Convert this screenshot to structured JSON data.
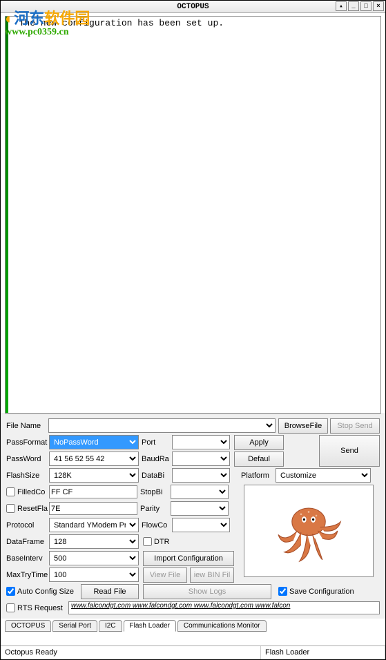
{
  "title": "OCTOPUS",
  "watermark": {
    "line1a": "河东",
    "line1b": "软件园",
    "line2": "www.pc0359.cn"
  },
  "console_text": "  The new configuration has been set up.",
  "form": {
    "file_name_label": "File Name",
    "file_name_value": "",
    "browse_file": "BrowseFile",
    "stop_send": "Stop Send",
    "passformat_label": "PassFormat",
    "passformat_value": "NoPassWord",
    "port_label": "Port",
    "port_value": "",
    "apply": "Apply",
    "send": "Send",
    "password_label": "PassWord",
    "password_value": "41 56 52 55 42",
    "baudrate_label": "BaudRa",
    "baudrate_value": "",
    "default": "Defaul",
    "flashsize_label": "FlashSize",
    "flashsize_value": "128K",
    "databits_label": "DataBi",
    "databits_value": "",
    "platform_label": "Platform",
    "platform_value": "Customize",
    "filledcode_label": "FilledCo",
    "filledcode_value": "FF CF",
    "stopbits_label": "StopBi",
    "stopbits_value": "",
    "resetflag_label": "ResetFla",
    "resetflag_value": "7E",
    "parity_label": "Parity",
    "parity_value": "",
    "protocol_label": "Protocol",
    "protocol_value": "Standard YModem Protoc",
    "flowcontrol_label": "FlowCo",
    "flowcontrol_value": "",
    "dtr_label": "DTR",
    "dataframe_label": "DataFrame",
    "dataframe_value": "128",
    "import_config": "Import Configuration",
    "baseinterval_label": "BaseInterv",
    "baseinterval_value": "500",
    "view_file": "View File",
    "view_bin": "iew BIN Fil",
    "maxtrytime_label": "MaxTryTime",
    "maxtrytime_value": "100",
    "auto_config_label": "Auto Config Size",
    "read_file": "Read File",
    "show_logs": "Show Logs",
    "save_config_label": "Save Configuration",
    "rts_label": "RTS Request",
    "url_text": "www.falcondgt.com www.falcondgt.com www.falcondgt.com www.falcon"
  },
  "tabs": [
    "OCTOPUS",
    "Serial Port",
    "I2C",
    "Flash Loader",
    "Communications Monitor"
  ],
  "status": {
    "left": "Octopus Ready",
    "right": "Flash Loader"
  }
}
